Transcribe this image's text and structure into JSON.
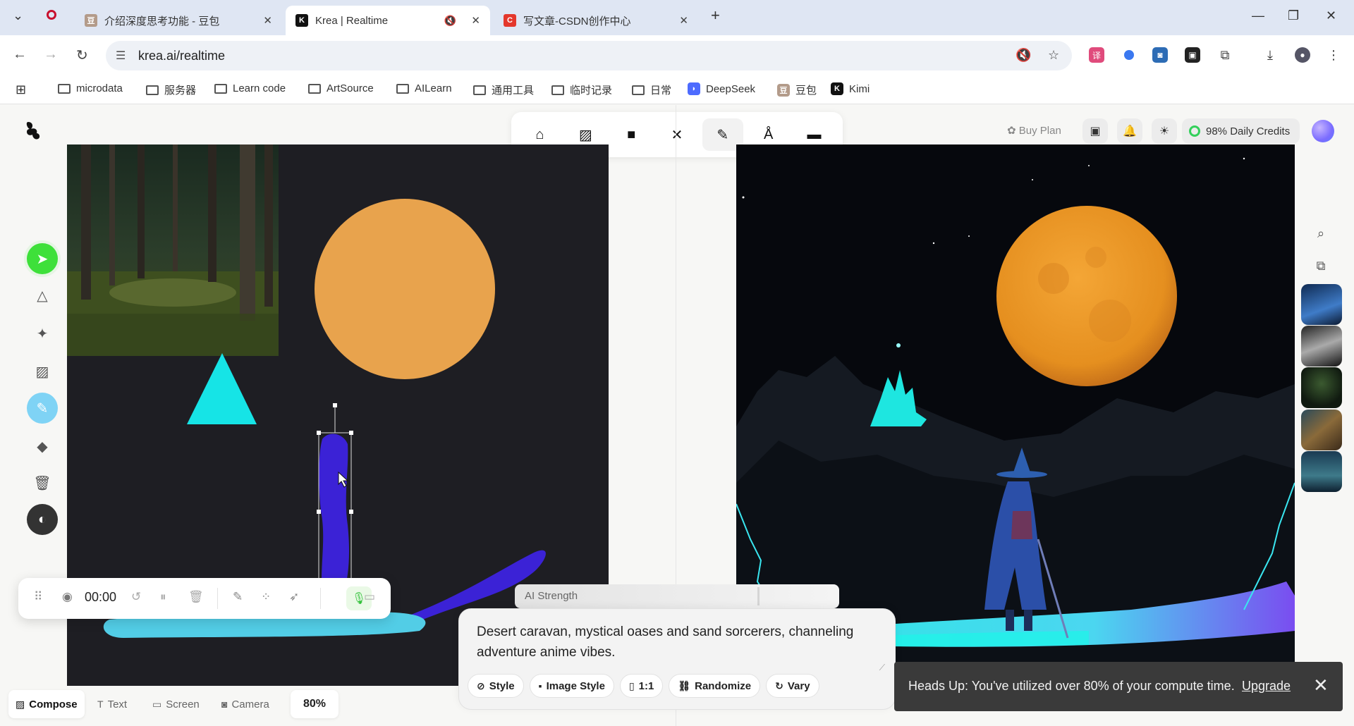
{
  "browser": {
    "tabs": [
      {
        "title": "介绍深度思考功能 - 豆包"
      },
      {
        "title": "Krea | Realtime"
      },
      {
        "title": "写文章-CSDN创作中心"
      }
    ],
    "url": "krea.ai/realtime",
    "bookmarks": [
      {
        "label": "microdata"
      },
      {
        "label": "服务器"
      },
      {
        "label": "Learn code"
      },
      {
        "label": "ArtSource"
      },
      {
        "label": "AILearn"
      },
      {
        "label": "通用工具"
      },
      {
        "label": "临时记录"
      },
      {
        "label": "日常"
      },
      {
        "label": "DeepSeek"
      },
      {
        "label": "豆包"
      },
      {
        "label": "Kimi"
      }
    ]
  },
  "header": {
    "buy_plan": "Buy Plan",
    "credits": "98% Daily Credits"
  },
  "recorder": {
    "time": "00:00"
  },
  "ai_strength_label": "AI Strength",
  "prompt": {
    "text": "Desert caravan, mystical oases and sand sorcerers, channeling adventure anime vibes.",
    "chips": {
      "style": "Style",
      "image_style": "Image Style",
      "ratio": "1:1",
      "randomize": "Randomize",
      "vary": "Vary"
    }
  },
  "modes": {
    "compose": "Compose",
    "text": "Text",
    "screen": "Screen",
    "camera": "Camera"
  },
  "zoom": "80%",
  "toast": {
    "message": "Heads Up: You've utilized over 80% of your compute time.",
    "action": "Upgrade"
  },
  "colors": {
    "accent_green": "#3ee03a",
    "canvas_bg": "#1e1e23",
    "moon": "#e8a34d",
    "triangle": "#16e4e6",
    "brush_purple": "#3b22d6",
    "brush_cyan": "#52cde6"
  }
}
